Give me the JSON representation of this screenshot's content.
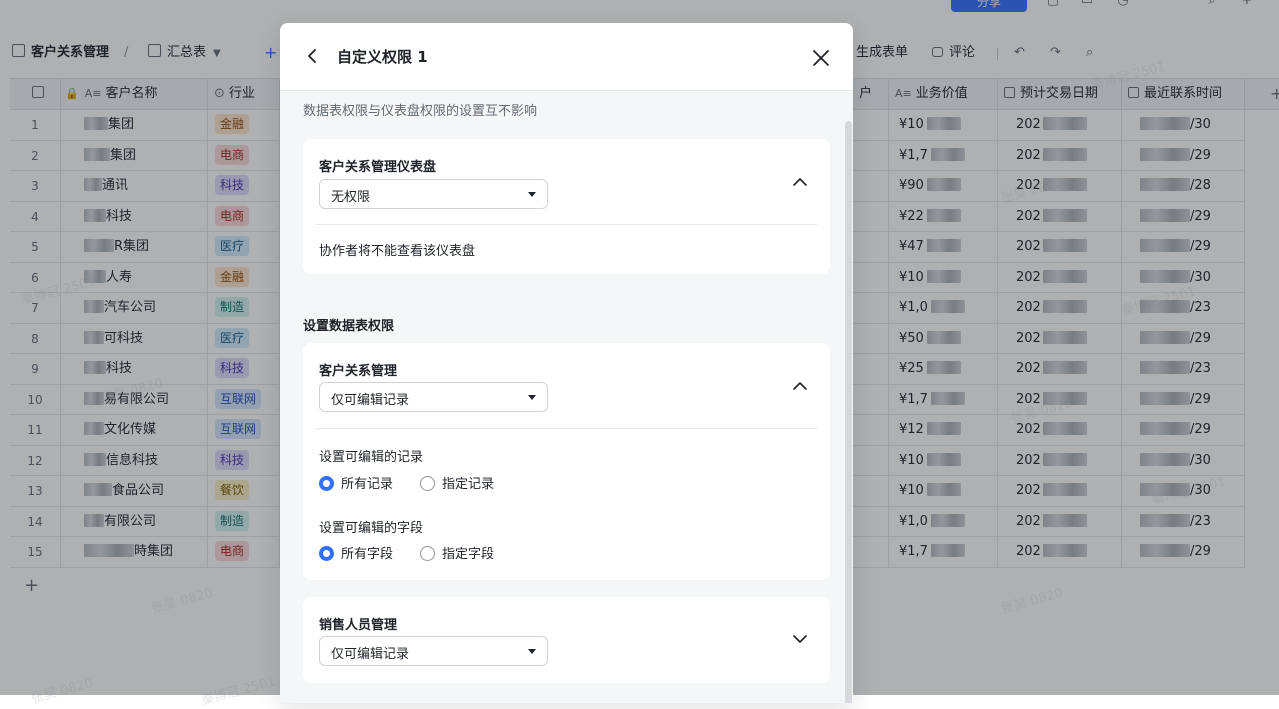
{
  "toolbar": {
    "base_name": "客户关系管理",
    "view_name": "汇总表",
    "generate_form": "生成表单",
    "comment": "评论",
    "share": "分享"
  },
  "grid": {
    "columns": {
      "name": "客户名称",
      "industry": "行业",
      "customer": "户",
      "value": "业务价值",
      "deal_date": "预计交易日期",
      "last_contact": "最近联系时间"
    },
    "rows": [
      {
        "num": "1",
        "name": "集团",
        "industry": "金融",
        "value": "¥10",
        "deal": "202",
        "contact": "/30"
      },
      {
        "num": "2",
        "name": "集团",
        "industry": "电商",
        "value": "¥1,7",
        "deal": "202",
        "contact": "/29"
      },
      {
        "num": "3",
        "name": "通讯",
        "industry": "科技",
        "value": "¥90",
        "deal": "202",
        "contact": "/28"
      },
      {
        "num": "4",
        "name": "科技",
        "industry": "电商",
        "value": "¥22",
        "deal": "202",
        "contact": "/29"
      },
      {
        "num": "5",
        "name": "R集团",
        "industry": "医疗",
        "value": "¥47",
        "deal": "202",
        "contact": "/29"
      },
      {
        "num": "6",
        "name": "人寿",
        "industry": "金融",
        "value": "¥10",
        "deal": "202",
        "contact": "/30"
      },
      {
        "num": "7",
        "name": "汽车公司",
        "industry": "制造",
        "value": "¥1,0",
        "deal": "202",
        "contact": "/23"
      },
      {
        "num": "8",
        "name": "可科技",
        "industry": "医疗",
        "value": "¥50",
        "deal": "202",
        "contact": "/29"
      },
      {
        "num": "9",
        "name": "科技",
        "industry": "科技",
        "value": "¥25",
        "deal": "202",
        "contact": "/23"
      },
      {
        "num": "10",
        "name": "易有限公司",
        "industry": "互联网",
        "value": "¥1,7",
        "deal": "202",
        "contact": "/29"
      },
      {
        "num": "11",
        "name": "文化传媒",
        "industry": "互联网",
        "value": "¥12",
        "deal": "202",
        "contact": "/29"
      },
      {
        "num": "12",
        "name": "信息科技",
        "industry": "科技",
        "value": "¥10",
        "deal": "202",
        "contact": "/30"
      },
      {
        "num": "13",
        "name": "食品公司",
        "industry": "餐饮",
        "value": "¥10",
        "deal": "202",
        "contact": "/30"
      },
      {
        "num": "14",
        "name": "有限公司",
        "industry": "制造",
        "value": "¥1,0",
        "deal": "202",
        "contact": "/23"
      },
      {
        "num": "15",
        "name": "時集团",
        "industry": "电商",
        "value": "¥1,7",
        "deal": "202",
        "contact": "/29"
      }
    ],
    "add_row": "+"
  },
  "tag_colors": {
    "金融": {
      "bg": "#fde6cf",
      "fg": "#8f4a06"
    },
    "电商": {
      "bg": "#fcd9d9",
      "fg": "#a82020"
    },
    "科技": {
      "bg": "#e0dcfc",
      "fg": "#4c30b0"
    },
    "医疗": {
      "bg": "#d4ecfb",
      "fg": "#125a8c"
    },
    "制造": {
      "bg": "#d5f2ef",
      "fg": "#0d6b63"
    },
    "互联网": {
      "bg": "#d7e4fd",
      "fg": "#1d4fb8"
    },
    "餐饮": {
      "bg": "#fbefc4",
      "fg": "#7a5c00"
    }
  },
  "watermark": {
    "a": "张昊 0820",
    "b": "秦博冠 2501"
  },
  "modal": {
    "title": "自定义权限 1",
    "note": "数据表权限与仪表盘权限的设置互不影响",
    "dashboard_card": {
      "title": "客户关系管理仪表盘",
      "select_value": "无权限",
      "desc": "协作者将不能查看该仪表盘"
    },
    "table_section_title": "设置数据表权限",
    "crm_card": {
      "title": "客户关系管理",
      "select_value": "仅可编辑记录",
      "records_label": "设置可编辑的记录",
      "records_all": "所有记录",
      "records_specific": "指定记录",
      "fields_label": "设置可编辑的字段",
      "fields_all": "所有字段",
      "fields_specific": "指定字段"
    },
    "sales_card": {
      "title": "销售人员管理",
      "select_value": "仅可编辑记录"
    }
  },
  "accent_color": "#3370ff"
}
